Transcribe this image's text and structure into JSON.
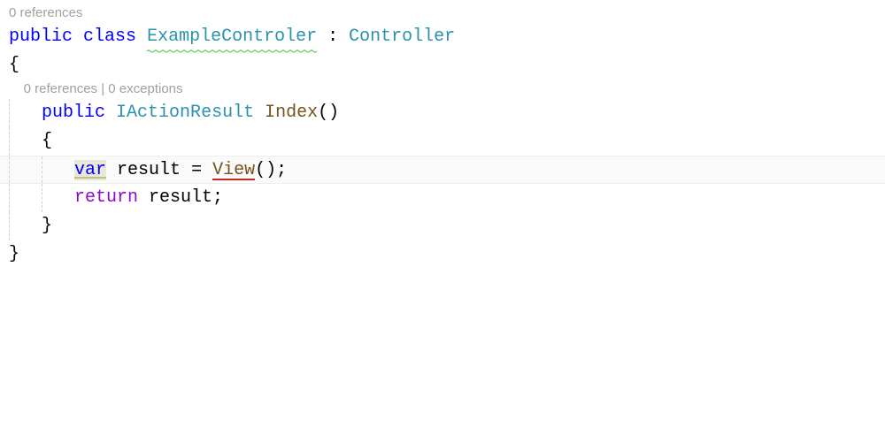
{
  "codelens_top": "0 references",
  "codelens_method": "0 references | 0 exceptions",
  "tokens": {
    "public": "public",
    "class": "class",
    "className": "ExampleControler",
    "colon": " : ",
    "baseType": "Controller",
    "returnType": "IActionResult",
    "methodName": "Index",
    "parens": "()",
    "var": "var",
    "resultDecl": " result = ",
    "viewCall": "View",
    "viewParens": "();",
    "return": "return",
    "resultRef": " result;",
    "openBrace": "{",
    "closeBrace": "}"
  },
  "indent": "    "
}
